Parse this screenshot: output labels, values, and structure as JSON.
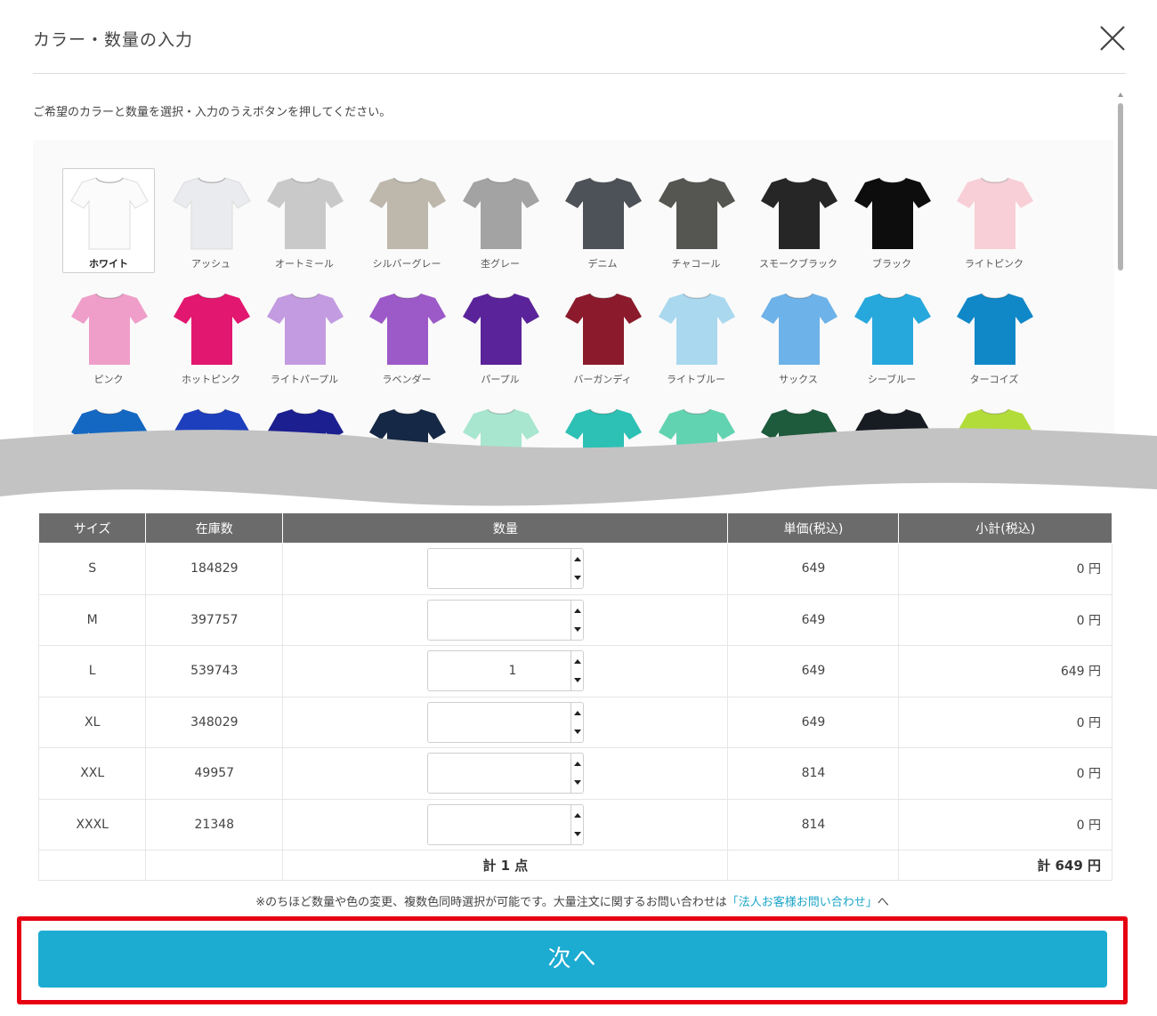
{
  "header": {
    "title": "カラー・数量の入力"
  },
  "instruction": "ご希望のカラーと数量を選択・入力のうえボタンを押してください。",
  "colors": [
    {
      "name": "ホワイト",
      "hex": "#fbfbfb"
    },
    {
      "name": "アッシュ",
      "hex": "#e9ebee"
    },
    {
      "name": "オートミール",
      "hex": "#c9c9c9"
    },
    {
      "name": "シルバーグレー",
      "hex": "#bdb7ac"
    },
    {
      "name": "杢グレー",
      "hex": "#a3a3a3"
    },
    {
      "name": "デニム",
      "hex": "#4d5258"
    },
    {
      "name": "チャコール",
      "hex": "#555552"
    },
    {
      "name": "スモークブラック",
      "hex": "#262626"
    },
    {
      "name": "ブラック",
      "hex": "#0d0d0d"
    },
    {
      "name": "ライトピンク",
      "hex": "#f8cfd6"
    },
    {
      "name": "ピンク",
      "hex": "#ef9ec9"
    },
    {
      "name": "ホットピンク",
      "hex": "#e2176f"
    },
    {
      "name": "ライトパープル",
      "hex": "#c39be0"
    },
    {
      "name": "ラベンダー",
      "hex": "#9c59c8"
    },
    {
      "name": "パープル",
      "hex": "#5b2399"
    },
    {
      "name": "バーガンディ",
      "hex": "#8b1b2c"
    },
    {
      "name": "ライトブルー",
      "hex": "#a9d8ef"
    },
    {
      "name": "サックス",
      "hex": "#6db2e8"
    },
    {
      "name": "シーブルー",
      "hex": "#27a8dc"
    },
    {
      "name": "ターコイズ",
      "hex": "#1087c7"
    },
    {
      "name": "",
      "hex": "#1568c2"
    },
    {
      "name": "",
      "hex": "#1d3fbe"
    },
    {
      "name": "",
      "hex": "#1c1f8f"
    },
    {
      "name": "",
      "hex": "#152845"
    },
    {
      "name": "",
      "hex": "#a8e6cf"
    },
    {
      "name": "",
      "hex": "#2dc0b4"
    },
    {
      "name": "",
      "hex": "#62d3b0"
    },
    {
      "name": "",
      "hex": "#1e5a3c"
    },
    {
      "name": "",
      "hex": "#171b22"
    },
    {
      "name": "",
      "hex": "#b2dc3a"
    }
  ],
  "selected_color": "ホワイト",
  "table": {
    "headers": [
      "サイズ",
      "在庫数",
      "数量",
      "単価(税込)",
      "小計(税込)"
    ],
    "rows": [
      {
        "size": "S",
        "stock": "184829",
        "qty": "",
        "price": "649",
        "subtotal": "0 円"
      },
      {
        "size": "M",
        "stock": "397757",
        "qty": "",
        "price": "649",
        "subtotal": "0 円"
      },
      {
        "size": "L",
        "stock": "539743",
        "qty": "1",
        "price": "649",
        "subtotal": "649 円"
      },
      {
        "size": "XL",
        "stock": "348029",
        "qty": "",
        "price": "649",
        "subtotal": "0 円"
      },
      {
        "size": "XXL",
        "stock": "49957",
        "qty": "",
        "price": "814",
        "subtotal": "0 円"
      },
      {
        "size": "XXXL",
        "stock": "21348",
        "qty": "",
        "price": "814",
        "subtotal": "0 円"
      }
    ],
    "total_qty": "計 1 点",
    "total_price": "計 649 円"
  },
  "note": {
    "prefix": "※のちほど数量や色の変更、複数色同時選択が可能です。大量注文に関するお問い合わせは",
    "link": "「法人お客様お問い合わせ」",
    "suffix": "へ"
  },
  "next_button": "次へ",
  "accents": {
    "button": "#1cabd1",
    "highlight": "#e60012",
    "header_bg": "#6b6b6b"
  }
}
